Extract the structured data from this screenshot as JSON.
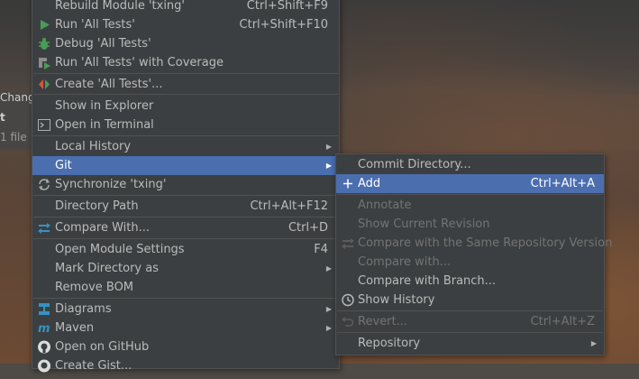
{
  "background": {
    "side_texts": [
      "Change",
      "t",
      "1 file"
    ]
  },
  "main_menu": {
    "items": [
      {
        "label": "Rebuild Module 'txing'",
        "shortcut": "Ctrl+Shift+F9"
      },
      {
        "label": "Run 'All Tests'",
        "shortcut": "Ctrl+Shift+F10",
        "icon": "run-icon"
      },
      {
        "label": "Debug 'All Tests'",
        "icon": "debug-icon"
      },
      {
        "label": "Run 'All Tests' with Coverage",
        "icon": "coverage-icon"
      },
      {
        "label": "Create 'All Tests'...",
        "icon": "create-test-icon"
      },
      {
        "label": "Show in Explorer"
      },
      {
        "label": "Open in Terminal",
        "icon": "terminal-icon"
      },
      {
        "label": "Local History",
        "submenu": true
      },
      {
        "label": "Git",
        "submenu": true,
        "selected": true
      },
      {
        "label": "Synchronize 'txing'",
        "icon": "sync-icon"
      },
      {
        "label": "Directory Path",
        "shortcut": "Ctrl+Alt+F12"
      },
      {
        "label": "Compare With...",
        "shortcut": "Ctrl+D",
        "icon": "compare-icon"
      },
      {
        "label": "Open Module Settings",
        "shortcut": "F4"
      },
      {
        "label": "Mark Directory as",
        "submenu": true
      },
      {
        "label": "Remove BOM"
      },
      {
        "label": "Diagrams",
        "submenu": true,
        "icon": "diagram-icon"
      },
      {
        "label": "Maven",
        "submenu": true,
        "icon": "maven-icon"
      },
      {
        "label": "Open on GitHub",
        "icon": "github-icon"
      },
      {
        "label": "Create Gist...",
        "icon": "github-icon"
      }
    ]
  },
  "git_submenu": {
    "items": [
      {
        "label": "Commit Directory..."
      },
      {
        "label": "Add",
        "shortcut": "Ctrl+Alt+A",
        "selected": true,
        "icon": "plus-icon"
      },
      {
        "label": "Annotate",
        "disabled": true
      },
      {
        "label": "Show Current Revision",
        "disabled": true
      },
      {
        "label": "Compare with the Same Repository Version",
        "disabled": true,
        "icon": "compare-icon"
      },
      {
        "label": "Compare with...",
        "disabled": true
      },
      {
        "label": "Compare with Branch..."
      },
      {
        "label": "Show History",
        "icon": "history-icon"
      },
      {
        "label": "Revert...",
        "shortcut": "Ctrl+Alt+Z",
        "disabled": true,
        "icon": "revert-icon"
      },
      {
        "label": "Repository",
        "submenu": true
      }
    ]
  },
  "submenu_arrow": "▶",
  "colors": {
    "menu_bg": "#3c3f41",
    "selection": "#4b6eaf",
    "text": "#bbbbbb",
    "disabled_text": "#737373",
    "run_green": "#499c54"
  }
}
